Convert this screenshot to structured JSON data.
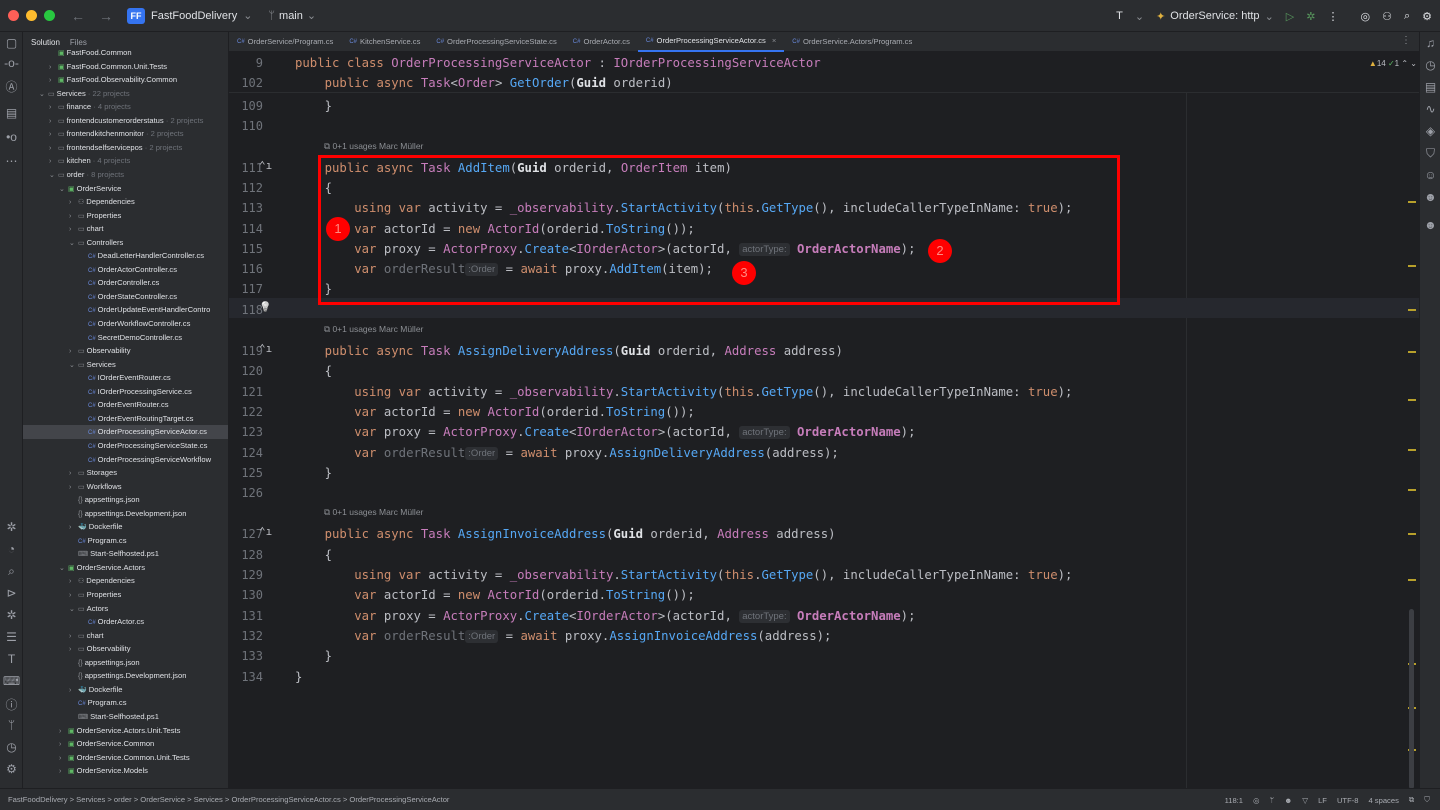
{
  "titlebar": {
    "project_initials": "FF",
    "project_name": "FastFoodDelivery",
    "branch": "main",
    "run_config": "OrderService: http"
  },
  "sidebar": {
    "tab_solution": "Solution",
    "tab_files": "Files",
    "tree": [
      {
        "depth": 2,
        "chev": "",
        "icon": "proj",
        "label": "FastFood.Common",
        "meta": ""
      },
      {
        "depth": 2,
        "chev": ">",
        "icon": "proj",
        "label": "FastFood.Common.Unit.Tests",
        "meta": ""
      },
      {
        "depth": 2,
        "chev": ">",
        "icon": "proj",
        "label": "FastFood.Observability.Common",
        "meta": ""
      },
      {
        "depth": 1,
        "chev": "v",
        "icon": "folder",
        "label": "Services",
        "meta": " · 22 projects"
      },
      {
        "depth": 2,
        "chev": ">",
        "icon": "folder",
        "label": "finance",
        "meta": " · 4 projects"
      },
      {
        "depth": 2,
        "chev": ">",
        "icon": "folder",
        "label": "frontendcustomerorderstatus",
        "meta": " · 2 projects"
      },
      {
        "depth": 2,
        "chev": ">",
        "icon": "folder",
        "label": "frontendkitchenmonitor",
        "meta": " · 2 projects"
      },
      {
        "depth": 2,
        "chev": ">",
        "icon": "folder",
        "label": "frontendselfservicepos",
        "meta": " · 2 projects"
      },
      {
        "depth": 2,
        "chev": ">",
        "icon": "folder",
        "label": "kitchen",
        "meta": " · 4 projects"
      },
      {
        "depth": 2,
        "chev": "v",
        "icon": "folder",
        "label": "order",
        "meta": " · 8 projects"
      },
      {
        "depth": 3,
        "chev": "v",
        "icon": "proj",
        "label": "OrderService",
        "meta": ""
      },
      {
        "depth": 4,
        "chev": ">",
        "icon": "dep",
        "label": "Dependencies",
        "meta": ""
      },
      {
        "depth": 4,
        "chev": ">",
        "icon": "folder",
        "label": "Properties",
        "meta": ""
      },
      {
        "depth": 4,
        "chev": ">",
        "icon": "folder",
        "label": "chart",
        "meta": ""
      },
      {
        "depth": 4,
        "chev": "v",
        "icon": "folder",
        "label": "Controllers",
        "meta": ""
      },
      {
        "depth": 5,
        "chev": "",
        "icon": "cs",
        "label": "DeadLetterHandlerController.cs",
        "meta": ""
      },
      {
        "depth": 5,
        "chev": "",
        "icon": "cs",
        "label": "OrderActorController.cs",
        "meta": ""
      },
      {
        "depth": 5,
        "chev": "",
        "icon": "cs",
        "label": "OrderController.cs",
        "meta": ""
      },
      {
        "depth": 5,
        "chev": "",
        "icon": "cs",
        "label": "OrderStateController.cs",
        "meta": ""
      },
      {
        "depth": 5,
        "chev": "",
        "icon": "cs",
        "label": "OrderUpdateEventHandlerContro",
        "meta": ""
      },
      {
        "depth": 5,
        "chev": "",
        "icon": "cs",
        "label": "OrderWorkflowController.cs",
        "meta": ""
      },
      {
        "depth": 5,
        "chev": "",
        "icon": "cs",
        "label": "SecretDemoController.cs",
        "meta": ""
      },
      {
        "depth": 4,
        "chev": ">",
        "icon": "folder",
        "label": "Observability",
        "meta": ""
      },
      {
        "depth": 4,
        "chev": "v",
        "icon": "folder",
        "label": "Services",
        "meta": ""
      },
      {
        "depth": 5,
        "chev": "",
        "icon": "cs",
        "label": "IOrderEventRouter.cs",
        "meta": ""
      },
      {
        "depth": 5,
        "chev": "",
        "icon": "cs",
        "label": "IOrderProcessingService.cs",
        "meta": ""
      },
      {
        "depth": 5,
        "chev": "",
        "icon": "cs",
        "label": "OrderEventRouter.cs",
        "meta": ""
      },
      {
        "depth": 5,
        "chev": "",
        "icon": "cs",
        "label": "OrderEventRoutingTarget.cs",
        "meta": ""
      },
      {
        "depth": 5,
        "chev": "",
        "icon": "cs",
        "label": "OrderProcessingServiceActor.cs",
        "meta": "",
        "selected": true
      },
      {
        "depth": 5,
        "chev": "",
        "icon": "cs",
        "label": "OrderProcessingServiceState.cs",
        "meta": ""
      },
      {
        "depth": 5,
        "chev": "",
        "icon": "cs",
        "label": "OrderProcessingServiceWorkflow",
        "meta": ""
      },
      {
        "depth": 4,
        "chev": ">",
        "icon": "folder",
        "label": "Storages",
        "meta": ""
      },
      {
        "depth": 4,
        "chev": ">",
        "icon": "folder",
        "label": "Workflows",
        "meta": ""
      },
      {
        "depth": 4,
        "chev": "",
        "icon": "json",
        "label": "appsettings.json",
        "meta": ""
      },
      {
        "depth": 4,
        "chev": "",
        "icon": "json",
        "label": "appsettings.Development.json",
        "meta": ""
      },
      {
        "depth": 4,
        "chev": ">",
        "icon": "docker",
        "label": "Dockerfile",
        "meta": ""
      },
      {
        "depth": 4,
        "chev": "",
        "icon": "cs",
        "label": "Program.cs",
        "meta": ""
      },
      {
        "depth": 4,
        "chev": "",
        "icon": "ps",
        "label": "Start-Selfhosted.ps1",
        "meta": ""
      },
      {
        "depth": 3,
        "chev": "v",
        "icon": "proj",
        "label": "OrderService.Actors",
        "meta": ""
      },
      {
        "depth": 4,
        "chev": ">",
        "icon": "dep",
        "label": "Dependencies",
        "meta": ""
      },
      {
        "depth": 4,
        "chev": ">",
        "icon": "folder",
        "label": "Properties",
        "meta": ""
      },
      {
        "depth": 4,
        "chev": "v",
        "icon": "folder",
        "label": "Actors",
        "meta": ""
      },
      {
        "depth": 5,
        "chev": "",
        "icon": "cs",
        "label": "OrderActor.cs",
        "meta": ""
      },
      {
        "depth": 4,
        "chev": ">",
        "icon": "folder",
        "label": "chart",
        "meta": ""
      },
      {
        "depth": 4,
        "chev": ">",
        "icon": "folder",
        "label": "Observability",
        "meta": ""
      },
      {
        "depth": 4,
        "chev": "",
        "icon": "json",
        "label": "appsettings.json",
        "meta": ""
      },
      {
        "depth": 4,
        "chev": "",
        "icon": "json",
        "label": "appsettings.Development.json",
        "meta": ""
      },
      {
        "depth": 4,
        "chev": ">",
        "icon": "docker",
        "label": "Dockerfile",
        "meta": ""
      },
      {
        "depth": 4,
        "chev": "",
        "icon": "cs",
        "label": "Program.cs",
        "meta": ""
      },
      {
        "depth": 4,
        "chev": "",
        "icon": "ps",
        "label": "Start-Selfhosted.ps1",
        "meta": ""
      },
      {
        "depth": 3,
        "chev": ">",
        "icon": "proj",
        "label": "OrderService.Actors.Unit.Tests",
        "meta": ""
      },
      {
        "depth": 3,
        "chev": ">",
        "icon": "proj",
        "label": "OrderService.Common",
        "meta": ""
      },
      {
        "depth": 3,
        "chev": ">",
        "icon": "proj",
        "label": "OrderService.Common.Unit.Tests",
        "meta": ""
      },
      {
        "depth": 3,
        "chev": ">",
        "icon": "proj",
        "label": "OrderService.Models",
        "meta": ""
      }
    ]
  },
  "tabs": [
    {
      "label": "OrderService/Program.cs",
      "active": false
    },
    {
      "label": "KitchenService.cs",
      "active": false
    },
    {
      "label": "OrderProcessingServiceState.cs",
      "active": false
    },
    {
      "label": "OrderActor.cs",
      "active": false
    },
    {
      "label": "OrderProcessingServiceActor.cs",
      "active": true
    },
    {
      "label": "OrderService.Actors/Program.cs",
      "active": false
    }
  ],
  "editor": {
    "inspection_warnings": "14",
    "inspection_ok": "1",
    "sticky_lines": [
      {
        "num": "9",
        "html": "<span class=\"kw\">public class</span> <span class=\"ty\">OrderProcessingServiceActor</span> : <span class=\"ty\">IOrderProcessingServiceActor</span>"
      },
      {
        "num": "102",
        "html": "    <span class=\"kw\">public async</span> <span class=\"ty\">Task</span>&lt;<span class=\"ty\">Order</span>&gt; <span class=\"fn\">GetOrder</span>(<span class=\"bd\">Guid</span> orderid)"
      }
    ],
    "lines": [
      {
        "num": "109",
        "html": "    }"
      },
      {
        "num": "110",
        "html": ""
      },
      {
        "num": "111",
        "mark": "^",
        "html": "    <span class=\"kw\">public async</span> <span class=\"ty\">Task</span> <span class=\"fn\">AddItem</span>(<span class=\"bd\">Guid</span> orderid, <span class=\"ty\">OrderItem</span> item)"
      },
      {
        "num": "112",
        "html": "    {"
      },
      {
        "num": "113",
        "html": "        <span class=\"kw\">using var</span> activity = <span class=\"pr\">_observability</span>.<span class=\"fn\">StartActivity</span>(<span class=\"kw\">this</span>.<span class=\"fn\">GetType</span>(), includeCallerTypeInName: <span class=\"kw\">true</span>);"
      },
      {
        "num": "114",
        "html": "        <span class=\"kw\">var</span> actorId = <span class=\"kw\">new</span> <span class=\"ty\">ActorId</span>(orderid.<span class=\"fn\">ToString</span>());"
      },
      {
        "num": "115",
        "html": "        <span class=\"kw\">var</span> proxy = <span class=\"ty\">ActorProxy</span>.<span class=\"fn\">Create</span>&lt;<span class=\"ty\">IOrderActor</span>&gt;(actorId, <span class=\"hint\">actorType:</span> <span class=\"bdp\">OrderActorName</span>);"
      },
      {
        "num": "116",
        "html": "        <span class=\"kw\">var</span> <span style=\"color:#6f737a\">orderResult</span><span class=\"hint\">:Order</span> = <span class=\"kw\">await</span> proxy.<span class=\"fn\">AddItem</span>(item);"
      },
      {
        "num": "117",
        "html": "    }"
      },
      {
        "num": "118",
        "mark": "bulb",
        "html": ""
      },
      {
        "num": "",
        "html": ""
      },
      {
        "num": "119",
        "mark": "^",
        "html": "    <span class=\"kw\">public async</span> <span class=\"ty\">Task</span> <span class=\"fn\">AssignDeliveryAddress</span>(<span class=\"bd\">Guid</span> orderid, <span class=\"ty\">Address</span> address)"
      },
      {
        "num": "120",
        "html": "    {"
      },
      {
        "num": "121",
        "html": "        <span class=\"kw\">using var</span> activity = <span class=\"pr\">_observability</span>.<span class=\"fn\">StartActivity</span>(<span class=\"kw\">this</span>.<span class=\"fn\">GetType</span>(), includeCallerTypeInName: <span class=\"kw\">true</span>);"
      },
      {
        "num": "122",
        "html": "        <span class=\"kw\">var</span> actorId = <span class=\"kw\">new</span> <span class=\"ty\">ActorId</span>(orderid.<span class=\"fn\">ToString</span>());"
      },
      {
        "num": "123",
        "html": "        <span class=\"kw\">var</span> proxy = <span class=\"ty\">ActorProxy</span>.<span class=\"fn\">Create</span>&lt;<span class=\"ty\">IOrderActor</span>&gt;(actorId, <span class=\"hint\">actorType:</span> <span class=\"bdp\">OrderActorName</span>);"
      },
      {
        "num": "124",
        "html": "        <span class=\"kw\">var</span> <span style=\"color:#6f737a\">orderResult</span><span class=\"hint\">:Order</span> = <span class=\"kw\">await</span> proxy.<span class=\"fn\">AssignDeliveryAddress</span>(address);"
      },
      {
        "num": "125",
        "html": "    }"
      },
      {
        "num": "126",
        "html": ""
      },
      {
        "num": "",
        "html": ""
      },
      {
        "num": "127",
        "mark": "^",
        "html": "    <span class=\"kw\">public async</span> <span class=\"ty\">Task</span> <span class=\"fn\">AssignInvoiceAddress</span>(<span class=\"bd\">Guid</span> orderid, <span class=\"ty\">Address</span> address)"
      },
      {
        "num": "128",
        "html": "    {"
      },
      {
        "num": "129",
        "html": "        <span class=\"kw\">using var</span> activity = <span class=\"pr\">_observability</span>.<span class=\"fn\">StartActivity</span>(<span class=\"kw\">this</span>.<span class=\"fn\">GetType</span>(), includeCallerTypeInName: <span class=\"kw\">true</span>);"
      },
      {
        "num": "130",
        "html": "        <span class=\"kw\">var</span> actorId = <span class=\"kw\">new</span> <span class=\"ty\">ActorId</span>(orderid.<span class=\"fn\">ToString</span>());"
      },
      {
        "num": "131",
        "html": "        <span class=\"kw\">var</span> proxy = <span class=\"ty\">ActorProxy</span>.<span class=\"fn\">Create</span>&lt;<span class=\"ty\">IOrderActor</span>&gt;(actorId, <span class=\"hint\">actorType:</span> <span class=\"bdp\">OrderActorName</span>);"
      },
      {
        "num": "132",
        "html": "        <span class=\"kw\">var</span> <span style=\"color:#6f737a\">orderResult</span><span class=\"hint\">:Order</span> = <span class=\"kw\">await</span> proxy.<span class=\"fn\">AssignInvoiceAddress</span>(address);"
      },
      {
        "num": "133",
        "html": "    }"
      },
      {
        "num": "134",
        "html": "}"
      }
    ],
    "usages": [
      {
        "text": "0+1 usages   Marc Müller"
      },
      {
        "text": "0+1 usages   Marc Müller"
      },
      {
        "text": "0+1 usages   Marc Müller"
      }
    ],
    "badges": [
      "1",
      "2",
      "3"
    ]
  },
  "statusbar": {
    "breadcrumbs": "FastFoodDelivery  >  Services  >  order  >  OrderService  >  Services  >  OrderProcessingServiceActor.cs  >  OrderProcessingServiceActor",
    "position": "118:1",
    "line_ending": "LF",
    "encoding": "UTF-8",
    "indent": "4 spaces"
  },
  "colors": {
    "accent": "#3574f0",
    "annotation_red": "#ff0000",
    "keyword": "#cf8e6d",
    "type": "#c77dbb",
    "function": "#56a8f5"
  }
}
